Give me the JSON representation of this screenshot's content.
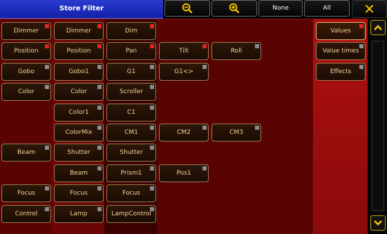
{
  "title": "Store Filter",
  "toolbar": {
    "zoom_out_icon": "zoom-out-icon",
    "zoom_in_icon": "zoom-in-icon",
    "none_label": "None",
    "all_label": "All",
    "close_icon": "close-icon"
  },
  "grid": {
    "col1": [
      "Dimmer",
      "Position",
      "Gobo",
      "Color",
      "Beam",
      "Focus",
      "Control"
    ],
    "col2": [
      "Dimmer",
      "Position",
      "Gobo1",
      "Color",
      "Color1",
      "ColorMix",
      "Shutter",
      "Beam",
      "Focus",
      "Lamp"
    ],
    "col3": [
      "Dim",
      "Pan",
      "G1",
      "Scroller",
      "C1",
      "CM1",
      "Shutter",
      "Prism1",
      "Focus",
      "LampControl"
    ],
    "col4": [
      "Tilt",
      "G1<>",
      "CM2",
      "Pos1"
    ],
    "col5": [
      "Roll",
      "CM3"
    ]
  },
  "side": {
    "values": "Values",
    "value_times": "Value times",
    "effects": "Effects"
  },
  "colors": {
    "accent": "#f6c200",
    "title_bar": "#1e2fc0",
    "panel": "#5a0303",
    "cell_text": "#f2d39a",
    "marker_active": "#e12424",
    "marker_inactive": "#8c8c8c"
  },
  "scrollbar": {
    "up_icon": "chevron-up-icon",
    "down_icon": "chevron-down-icon"
  }
}
